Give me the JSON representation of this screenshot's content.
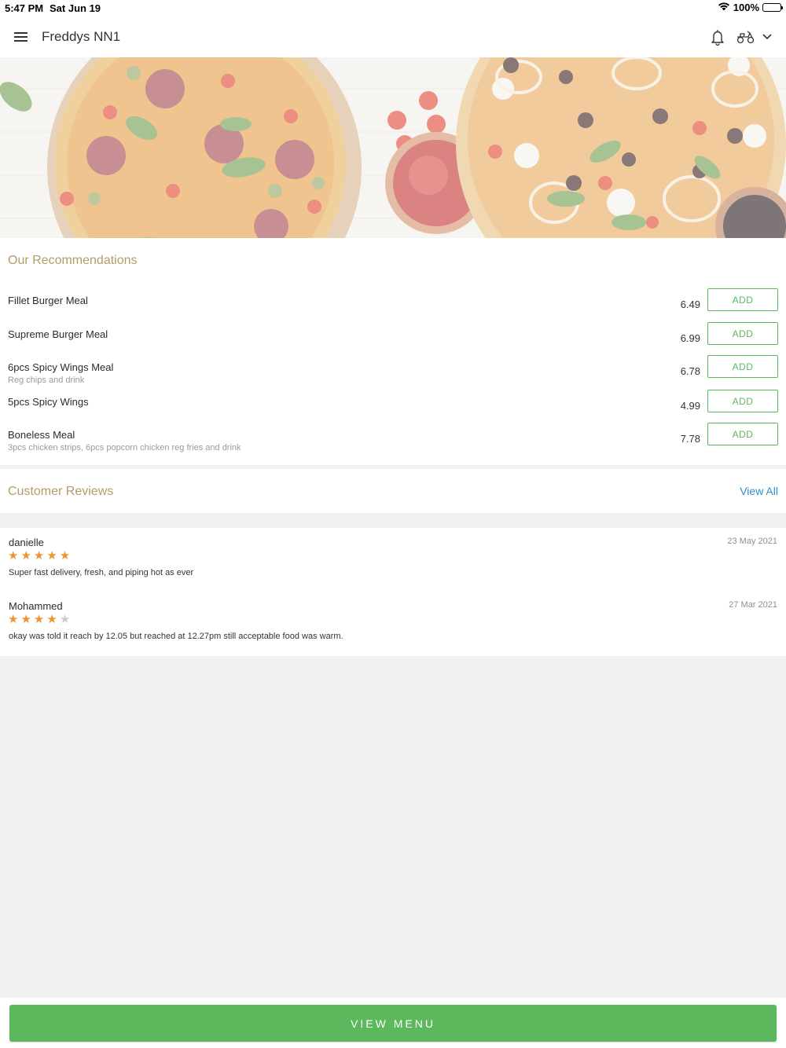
{
  "status_bar": {
    "time": "5:47 PM",
    "date": "Sat Jun 19",
    "battery": "100%"
  },
  "header": {
    "title": "Freddys NN1"
  },
  "recommendations": {
    "title": "Our Recommendations",
    "add_label": "ADD",
    "items": [
      {
        "name": "Fillet Burger Meal",
        "desc": "",
        "price": "6.49"
      },
      {
        "name": "Supreme Burger Meal",
        "desc": "",
        "price": "6.99"
      },
      {
        "name": "6pcs Spicy Wings Meal",
        "desc": "Reg chips and drink",
        "price": "6.78"
      },
      {
        "name": "5pcs Spicy Wings",
        "desc": "",
        "price": "4.99"
      },
      {
        "name": "Boneless Meal",
        "desc": "3pcs chicken strips, 6pcs popcorn chicken reg fries and drink",
        "price": "7.78"
      }
    ]
  },
  "reviews": {
    "title": "Customer Reviews",
    "view_all": "View All",
    "items": [
      {
        "author": "danielle",
        "date": "23 May 2021",
        "rating": 5,
        "text": "Super fast delivery, fresh, and piping hot as ever"
      },
      {
        "author": "Mohammed",
        "date": "27 Mar 2021",
        "rating": 4,
        "text": "okay was told it reach by 12.05 but reached at 12.27pm still acceptable food was warm."
      }
    ]
  },
  "bottom": {
    "view_menu": "VIEW MENU"
  },
  "colors": {
    "accent_green": "#5cb85c",
    "section_gold": "#b39b6a",
    "link_blue": "#2f8fce",
    "star_orange": "#f0922f",
    "star_empty": "#cccccc"
  }
}
